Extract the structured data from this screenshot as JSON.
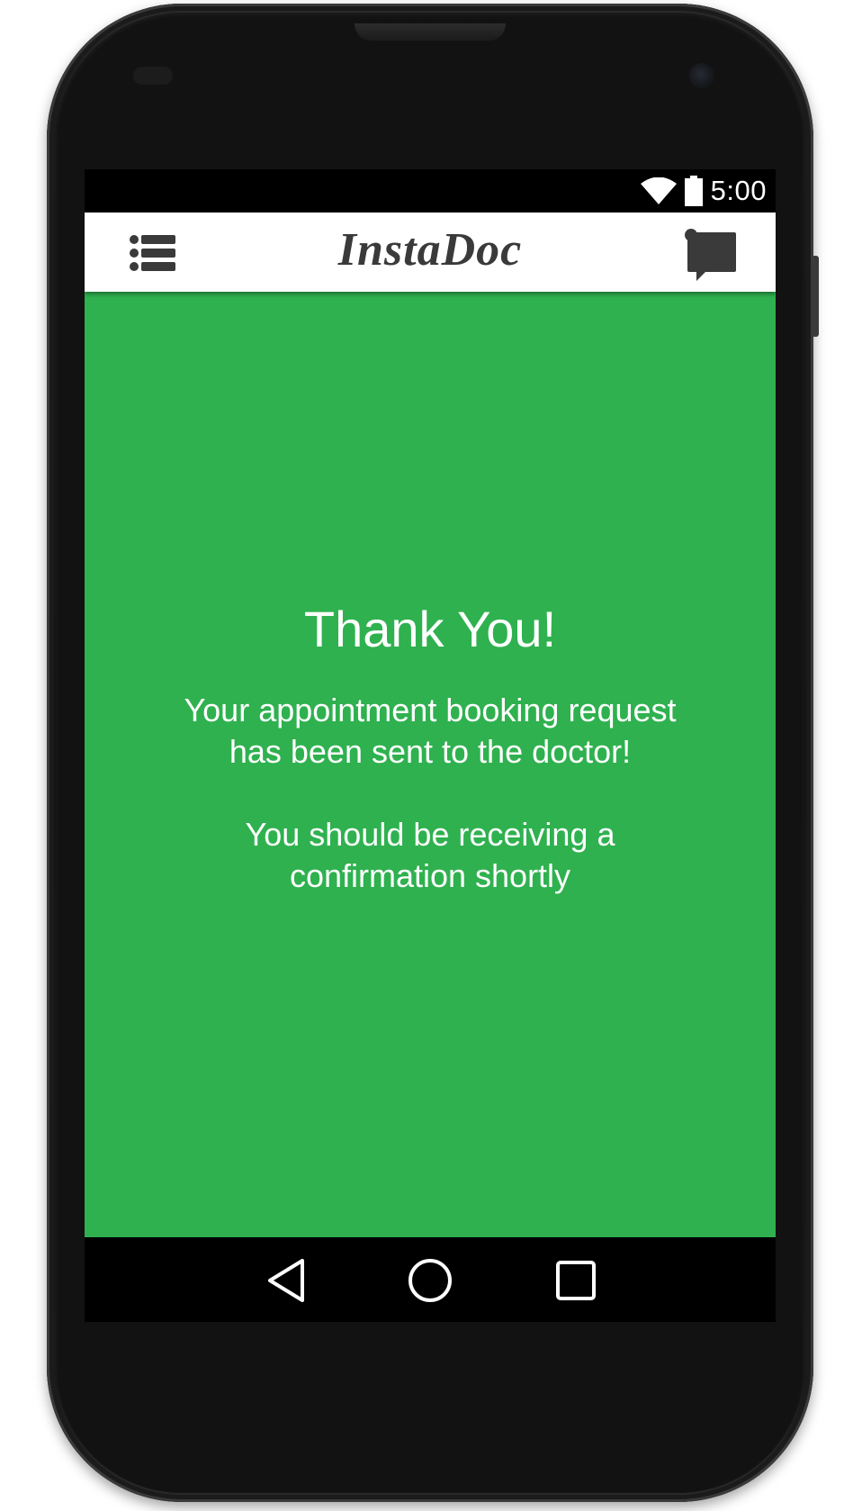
{
  "status_bar": {
    "time": "5:00",
    "wifi_icon": "wifi-icon",
    "battery_icon": "battery-icon"
  },
  "app_bar": {
    "title": "InstaDoc",
    "menu_icon": "list-menu-icon",
    "chat_icon": "chat-bubble-icon"
  },
  "main": {
    "heading": "Thank You!",
    "message_line1": "Your appointment booking request",
    "message_line2": "has been sent to the doctor!",
    "confirm_line1": "You should be receiving a",
    "confirm_line2": "confirmation shortly"
  },
  "nav_bar": {
    "back_icon": "back-triangle-icon",
    "home_icon": "home-circle-icon",
    "recents_icon": "recents-square-icon"
  },
  "colors": {
    "content_background": "#2fb14f",
    "app_bar_background": "#ffffff",
    "title_text": "#3a3a3a",
    "content_text": "#ffffff"
  }
}
